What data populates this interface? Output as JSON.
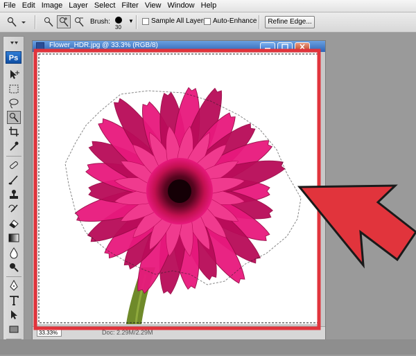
{
  "menu": [
    {
      "id": "file",
      "label": "File"
    },
    {
      "id": "edit",
      "label": "Edit"
    },
    {
      "id": "image",
      "label": "Image"
    },
    {
      "id": "layer",
      "label": "Layer"
    },
    {
      "id": "select",
      "label": "Select"
    },
    {
      "id": "filter",
      "label": "Filter"
    },
    {
      "id": "view",
      "label": "View"
    },
    {
      "id": "window",
      "label": "Window"
    },
    {
      "id": "help",
      "label": "Help"
    }
  ],
  "options": {
    "brush_label": "Brush:",
    "brush_size": "30",
    "sample_all_layers": {
      "label": "Sample All Layers",
      "checked": false
    },
    "auto_enhance": {
      "label": "Auto-Enhance",
      "checked": false
    },
    "refine_edge": "Refine Edge..."
  },
  "toolbox": {
    "logo": "Ps",
    "tools": [
      "move-icon",
      "marquee-icon",
      "lasso-icon",
      "quick-selection-icon",
      "crop-icon",
      "eyedropper-icon",
      "healing-brush-icon",
      "brush-icon",
      "clone-stamp-icon",
      "history-brush-icon",
      "eraser-icon",
      "gradient-icon",
      "blur-icon",
      "dodge-icon",
      "pen-icon",
      "type-icon",
      "path-selection-icon",
      "rectangle-icon",
      "notes-icon",
      "eyedropper-bottom-icon"
    ],
    "active_tool": "quick-selection-icon"
  },
  "document": {
    "title": "Flower_HDR.jpg @ 33.3% (RGB/8)",
    "zoom": "33.33%",
    "info": "Doc: 2.29M/2.29M"
  },
  "colors": {
    "flower": "#e8197d",
    "flower_dark": "#b80b58",
    "center": "#6a0a2c",
    "stem": "#6f8a2a",
    "highlight": "#e1343c"
  }
}
